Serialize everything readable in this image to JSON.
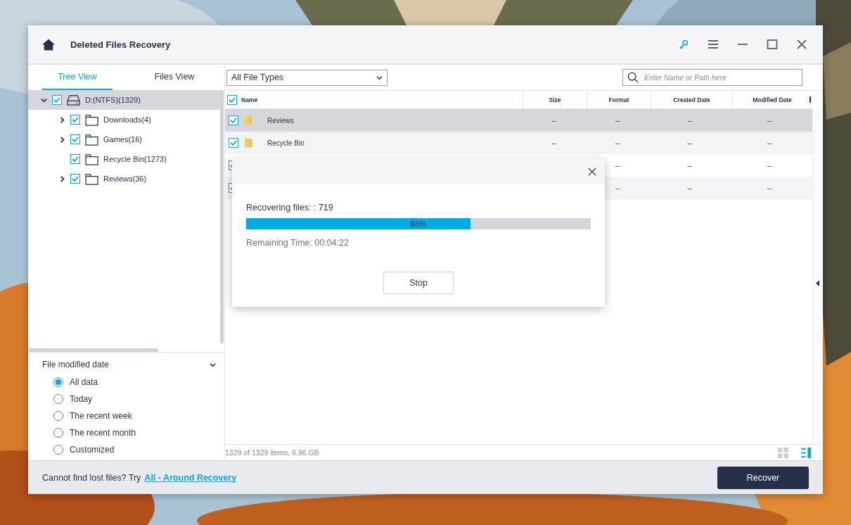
{
  "window": {
    "title": "Deleted Files Recovery"
  },
  "tabs": [
    {
      "label": "Tree View",
      "selected": true
    },
    {
      "label": "Files View",
      "selected": false
    }
  ],
  "file_type_filter": {
    "value": "All File Types"
  },
  "search": {
    "placeholder": "Enter Name or Path here"
  },
  "tree": [
    {
      "label": "D:(NTFS)(1329)",
      "kind": "drive",
      "checked": true,
      "expanded": true,
      "selected": true,
      "children": [
        {
          "label": "Downloads(4)",
          "kind": "folder",
          "checked": true,
          "expanded": false,
          "selected": false
        },
        {
          "label": "Games(16)",
          "kind": "folder",
          "checked": true,
          "expanded": false,
          "selected": false
        },
        {
          "label": "Recycle Bin(1273)",
          "kind": "folder",
          "checked": true,
          "selected": false
        },
        {
          "label": "Reviews(36)",
          "kind": "folder",
          "checked": true,
          "expanded": false,
          "selected": false
        }
      ]
    }
  ],
  "date_filter": {
    "title": "File modified date",
    "options": [
      {
        "label": "All data",
        "selected": true
      },
      {
        "label": "Today",
        "selected": false
      },
      {
        "label": "The recent week",
        "selected": false
      },
      {
        "label": "The recent month",
        "selected": false
      },
      {
        "label": "Customized",
        "selected": false
      }
    ]
  },
  "table": {
    "all_checked": true,
    "columns": [
      "Name",
      "Size",
      "Format",
      "Created Date",
      "Modified Date"
    ],
    "rows": [
      {
        "checked": true,
        "selected": true,
        "name": "Reviews",
        "size": "--",
        "format": "--",
        "created": "--",
        "modified": "--"
      },
      {
        "checked": true,
        "selected": false,
        "name": "Recycle Bin",
        "size": "--",
        "format": "--",
        "created": "--",
        "modified": "--"
      },
      {
        "checked": true,
        "selected": false,
        "format": "--",
        "created": "--",
        "modified": "--"
      },
      {
        "checked": true,
        "selected": false,
        "format": "--",
        "created": "--",
        "modified": "--"
      }
    ]
  },
  "status_bar": {
    "text": "1329 of 1329 items, 6.96 GB",
    "views": [
      {
        "kind": "grid",
        "selected": false
      },
      {
        "kind": "list",
        "selected": true
      }
    ]
  },
  "dialog": {
    "message": "Recovering files: : 719",
    "level": 0.65,
    "percent": "65%",
    "remaining": "Remaining Time: 00:04:22",
    "button": "Stop"
  },
  "footer": {
    "hint": "Cannot find lost files? Try",
    "link": "All - Around Recovery",
    "button": "Recover"
  }
}
